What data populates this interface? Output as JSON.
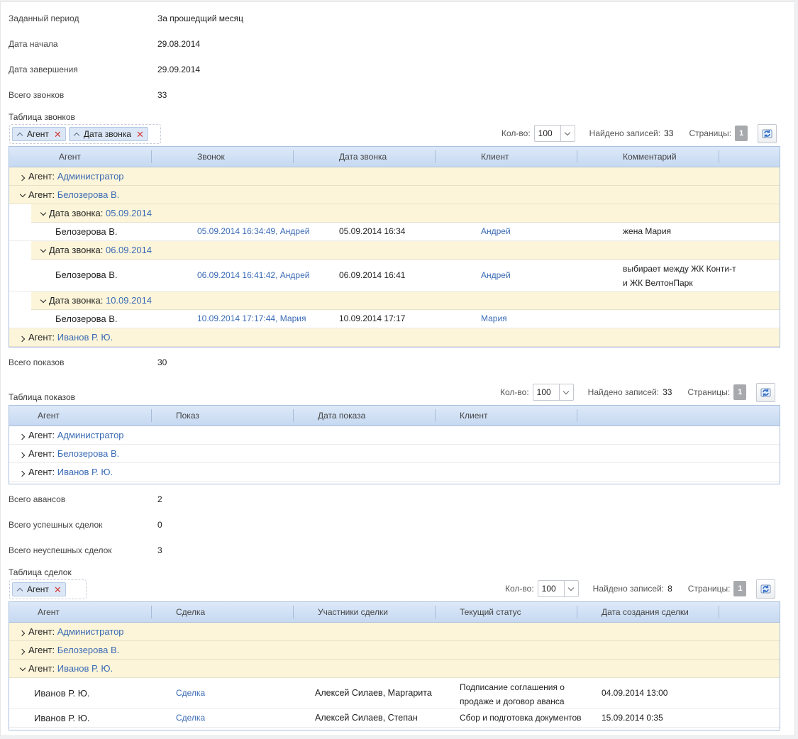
{
  "summary": [
    {
      "label": "Заданный период",
      "value": "За прошедщий месяц"
    },
    {
      "label": "Дата начала",
      "value": "29.08.2014"
    },
    {
      "label": "Дата завершения",
      "value": "29.09.2014"
    },
    {
      "label": "Всего звонков",
      "value": "33"
    }
  ],
  "calls": {
    "title": "Таблица звонков",
    "chips": [
      "Агент",
      "Дата звонка"
    ],
    "qty_label": "Кол-во:",
    "qty_value": "100",
    "found_label": "Найдено записей:",
    "found_value": "33",
    "pages_label": "Страницы:",
    "page": "1",
    "columns": [
      "Агент",
      "Звонок",
      "Дата звонка",
      "Клиент",
      "Комментарий"
    ],
    "groups": [
      {
        "label": "Агент:",
        "value": "Администратор"
      },
      {
        "label": "Агент:",
        "value": "Белозерова В."
      },
      {
        "label": "Дата звонка:",
        "value": "05.09.2014"
      },
      {
        "label": "Дата звонка:",
        "value": "06.09.2014"
      },
      {
        "label": "Дата звонка:",
        "value": "10.09.2014"
      },
      {
        "label": "Агент:",
        "value": "Иванов Р. Ю."
      }
    ],
    "rows": [
      {
        "agent": "Белозерова В.",
        "call": "05.09.2014 16:34:49, Андрей",
        "date": "05.09.2014 16:34",
        "client": "Андрей",
        "comment": "жена Мария"
      },
      {
        "agent": "Белозерова В.",
        "call": "06.09.2014 16:41:42, Андрей",
        "date": "06.09.2014 16:41",
        "client": "Андрей",
        "comment": "выбирает между ЖК Конти-т",
        "comment2": "и ЖК ВелтонПарк"
      },
      {
        "agent": "Белозерова В.",
        "call": "10.09.2014 17:17:44, Мария",
        "date": "10.09.2014 17:17",
        "client": "Мария",
        "comment": ""
      }
    ]
  },
  "shows_total": {
    "label": "Всего показов",
    "value": "30"
  },
  "shows": {
    "title": "Таблица показов",
    "qty_label": "Кол-во:",
    "qty_value": "100",
    "found_label": "Найдено записей:",
    "found_value": "33",
    "pages_label": "Страницы:",
    "page": "1",
    "columns": [
      "Агент",
      "Показ",
      "Дата показа",
      "Клиент"
    ],
    "groups": [
      {
        "label": "Агент:",
        "value": "Администратор"
      },
      {
        "label": "Агент:",
        "value": "Белозерова В."
      },
      {
        "label": "Агент:",
        "value": "Иванов Р. Ю."
      }
    ]
  },
  "totals2": [
    {
      "label": "Всего авансов",
      "value": "2"
    },
    {
      "label": "Всего успешных сделок",
      "value": "0"
    },
    {
      "label": "Всего неуспешных сделок",
      "value": "3"
    }
  ],
  "deals": {
    "title": "Таблица сделок",
    "chips": [
      "Агент"
    ],
    "qty_label": "Кол-во:",
    "qty_value": "100",
    "found_label": "Найдено записей:",
    "found_value": "8",
    "pages_label": "Страницы:",
    "page": "1",
    "columns": [
      "Агент",
      "Сделка",
      "Участники сделки",
      "Текущий статус",
      "Дата создания сделки"
    ],
    "groups": [
      {
        "label": "Агент:",
        "value": "Администратор"
      },
      {
        "label": "Агент:",
        "value": "Белозерова В."
      },
      {
        "label": "Агент:",
        "value": "Иванов Р. Ю."
      }
    ],
    "rows": [
      {
        "agent": "Иванов Р. Ю.",
        "deal": "Сделка",
        "members": "Алексей Силаев, Маргарита",
        "status": "Подписание соглашения о",
        "status2": "продаже и договор аванса",
        "created": "04.09.2014 13:00"
      },
      {
        "agent": "Иванов Р. Ю.",
        "deal": "Сделка",
        "members": "Алексей Силаев, Степан",
        "status": "Сбор и подготовка документов",
        "created": "15.09.2014 0:35"
      }
    ]
  },
  "icons": {
    "expand": "chevron-right-icon",
    "collapse": "chevron-down-icon",
    "refresh": "refresh-icon",
    "remove": "close-icon",
    "sort": "sort-up-icon"
  },
  "colors": {
    "link": "#3a6ab5",
    "group_bg": "#fdf5d9",
    "header_bg": "#c6d9f1",
    "chip_close": "#d43a3a"
  }
}
